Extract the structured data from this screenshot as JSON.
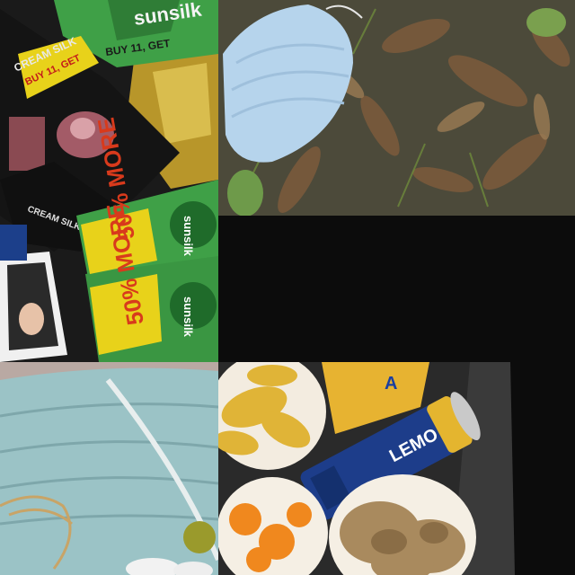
{
  "collage": {
    "tiles": [
      {
        "id": "sachets",
        "subject": "shampoo sachet packets"
      },
      {
        "id": "mask-leaves",
        "subject": "surgical mask on dry leaves"
      },
      {
        "id": "blank",
        "subject": "empty black area"
      },
      {
        "id": "masks-bag",
        "subject": "used face masks"
      },
      {
        "id": "food-waste",
        "subject": "food scraps and drink can"
      }
    ]
  },
  "sachets": {
    "promo_buy": "BUY 11, GET",
    "brand": "sunsilk",
    "brand_alt": "CREAM SILK",
    "promo_more": "50% MORE",
    "colors": {
      "green": "#3fa047",
      "yellow": "#e8d21a",
      "black": "#141414"
    }
  },
  "can": {
    "label": "LEMO"
  }
}
